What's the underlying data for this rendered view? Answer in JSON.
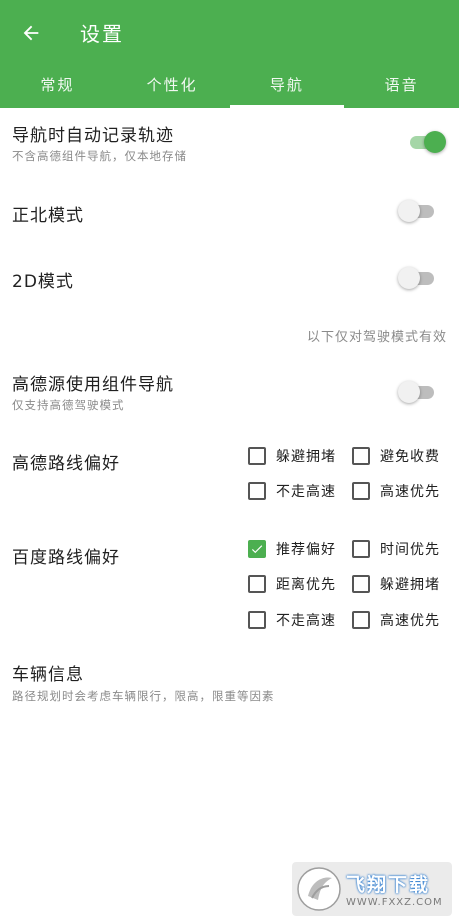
{
  "header": {
    "title": "设置",
    "back_icon": "arrow-left-icon",
    "background": "#4caf50"
  },
  "tabs": [
    {
      "label": "常规",
      "active": false
    },
    {
      "label": "个性化",
      "active": false
    },
    {
      "label": "导航",
      "active": true
    },
    {
      "label": "语音",
      "active": false
    }
  ],
  "settings": {
    "auto_track": {
      "title": "导航时自动记录轨迹",
      "subtitle": "不含高德组件导航，仅本地存储",
      "enabled": true
    },
    "north_up": {
      "title": "正北模式",
      "enabled": false
    },
    "mode_2d": {
      "title": "2D模式",
      "enabled": false
    },
    "note": "以下仅对驾驶模式有效",
    "amap_component": {
      "title": "高德源使用组件导航",
      "subtitle": "仅支持高德驾驶模式",
      "enabled": false
    },
    "amap_route": {
      "title": "高德路线偏好",
      "options": [
        {
          "label": "躲避拥堵",
          "checked": false
        },
        {
          "label": "避免收费",
          "checked": false
        },
        {
          "label": "不走高速",
          "checked": false
        },
        {
          "label": "高速优先",
          "checked": false
        }
      ]
    },
    "baidu_route": {
      "title": "百度路线偏好",
      "options": [
        {
          "label": "推荐偏好",
          "checked": true
        },
        {
          "label": "时间优先",
          "checked": false
        },
        {
          "label": "距离优先",
          "checked": false
        },
        {
          "label": "躲避拥堵",
          "checked": false
        },
        {
          "label": "不走高速",
          "checked": false
        },
        {
          "label": "高速优先",
          "checked": false
        }
      ]
    },
    "vehicle": {
      "title": "车辆信息",
      "subtitle": "路径规划时会考虑车辆限行，限高，限重等因素"
    }
  },
  "watermark": {
    "name": "飞翔下载",
    "domain": "WWW.FXXZ.COM",
    "icon": "fxxz-logo-icon"
  },
  "colors": {
    "accent": "#4caf50",
    "switch_on_track": "#a5d6a7",
    "switch_off_track": "#bdbdbd",
    "secondary_text": "#8a8a8a"
  }
}
